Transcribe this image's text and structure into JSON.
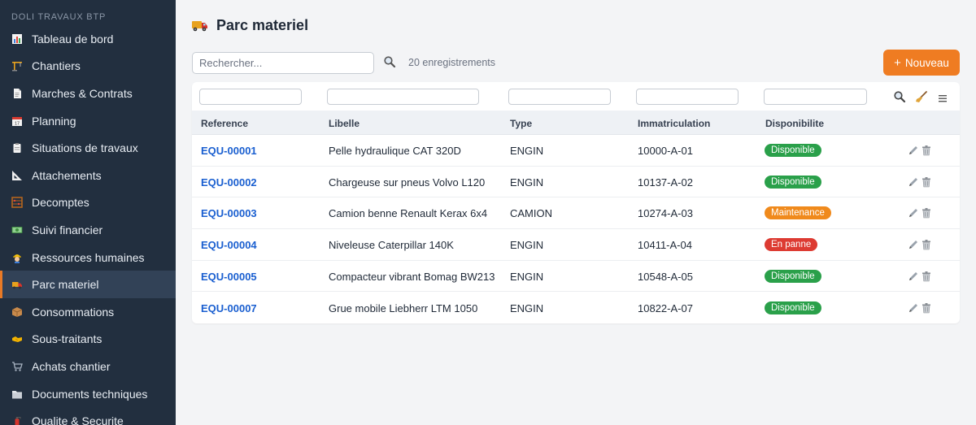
{
  "sidebar": {
    "brand": "DOLI TRAVAUX BTP",
    "items": [
      {
        "label": "Tableau de bord",
        "icon": "chart-icon"
      },
      {
        "label": "Chantiers",
        "icon": "crane-icon"
      },
      {
        "label": "Marches & Contrats",
        "icon": "document-icon"
      },
      {
        "label": "Planning",
        "icon": "calendar-icon"
      },
      {
        "label": "Situations de travaux",
        "icon": "clipboard-icon"
      },
      {
        "label": "Attachements",
        "icon": "ruler-icon"
      },
      {
        "label": "Decomptes",
        "icon": "abacus-icon"
      },
      {
        "label": "Suivi financier",
        "icon": "money-icon"
      },
      {
        "label": "Ressources humaines",
        "icon": "worker-icon"
      },
      {
        "label": "Parc materiel",
        "icon": "truck-icon",
        "active": true
      },
      {
        "label": "Consommations",
        "icon": "package-icon"
      },
      {
        "label": "Sous-traitants",
        "icon": "handshake-icon"
      },
      {
        "label": "Achats chantier",
        "icon": "cart-icon"
      },
      {
        "label": "Documents techniques",
        "icon": "folder-icon"
      },
      {
        "label": "Qualite & Securite",
        "icon": "extinguisher-icon"
      }
    ]
  },
  "header": {
    "title": "Parc materiel",
    "search_placeholder": "Rechercher...",
    "count": "20 enregistrements",
    "new_label": "Nouveau",
    "new_plus": "+"
  },
  "table": {
    "columns": [
      "Reference",
      "Libelle",
      "Type",
      "Immatriculation",
      "Disponibilite"
    ],
    "rows": [
      {
        "ref": "EQU-00001",
        "libelle": "Pelle hydraulique CAT 320D",
        "type": "ENGIN",
        "immat": "10000-A-01",
        "dispo": "Disponible",
        "status": "ok"
      },
      {
        "ref": "EQU-00002",
        "libelle": "Chargeuse sur pneus Volvo L120",
        "type": "ENGIN",
        "immat": "10137-A-02",
        "dispo": "Disponible",
        "status": "ok"
      },
      {
        "ref": "EQU-00003",
        "libelle": "Camion benne Renault Kerax 6x4",
        "type": "CAMION",
        "immat": "10274-A-03",
        "dispo": "Maintenance",
        "status": "warn"
      },
      {
        "ref": "EQU-00004",
        "libelle": "Niveleuse Caterpillar 140K",
        "type": "ENGIN",
        "immat": "10411-A-04",
        "dispo": "En panne",
        "status": "err"
      },
      {
        "ref": "EQU-00005",
        "libelle": "Compacteur vibrant Bomag BW213",
        "type": "ENGIN",
        "immat": "10548-A-05",
        "dispo": "Disponible",
        "status": "ok"
      },
      {
        "ref": "EQU-00007",
        "libelle": "Grue mobile Liebherr LTM 1050",
        "type": "ENGIN",
        "immat": "10822-A-07",
        "dispo": "Disponible",
        "status": "ok"
      }
    ]
  },
  "colors": {
    "sidebar_bg": "#222f3f",
    "accent": "#ef7c22",
    "link": "#1a5fd0",
    "status_ok": "#2aa04a",
    "status_warn": "#f08a1c",
    "status_err": "#dd3b32"
  }
}
